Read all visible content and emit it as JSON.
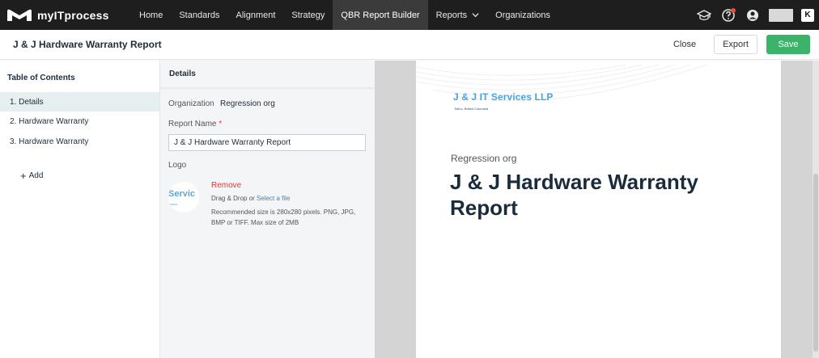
{
  "app": {
    "name": "myITprocess"
  },
  "nav": {
    "items": [
      {
        "label": "Home"
      },
      {
        "label": "Standards"
      },
      {
        "label": "Alignment"
      },
      {
        "label": "Strategy"
      },
      {
        "label": "QBR Report Builder"
      },
      {
        "label": "Reports"
      },
      {
        "label": "Organizations"
      }
    ],
    "active": "QBR Report Builder",
    "icons": [
      "graduation-cap-icon",
      "help-icon",
      "user-icon",
      "brand-k-icon"
    ],
    "brand_k": "K"
  },
  "header": {
    "title": "J & J Hardware Warranty Report",
    "close_label": "Close",
    "export_label": "Export",
    "save_label": "Save"
  },
  "toc": {
    "title": "Table of Contents",
    "items": [
      {
        "label": "1. Details"
      },
      {
        "label": "2. Hardware Warranty"
      },
      {
        "label": "3. Hardware Warranty"
      }
    ],
    "add_label": "Add"
  },
  "details": {
    "title": "Details",
    "organization_label": "Organization",
    "organization_value": "Regression org",
    "report_name_label": "Report Name",
    "required_mark": "*",
    "report_name_value": "J & J Hardware Warranty Report",
    "logo_label": "Logo",
    "logo_thumb_text": "Servic",
    "logo_thumb_sub": "mbia",
    "remove_label": "Remove",
    "drop_prefix": "Drag & Drop or ",
    "select_file_label": "Select a file",
    "recommendation": "Recommended size is 280x280 pixels. PNG, JPG, BMP or TIFF. Max size of 2MB"
  },
  "preview": {
    "company_name": "J & J IT Services LLP",
    "company_location": "Tofino, British Columbia",
    "organization": "Regression org",
    "report_title": "J & J Hardware Warranty Report"
  },
  "colors": {
    "nav_bg": "#1e1e1e",
    "save_green": "#3bb36b",
    "remove_red": "#e53935",
    "logo_blue": "#4aa3e0",
    "active_toc": "#e7eef0"
  }
}
